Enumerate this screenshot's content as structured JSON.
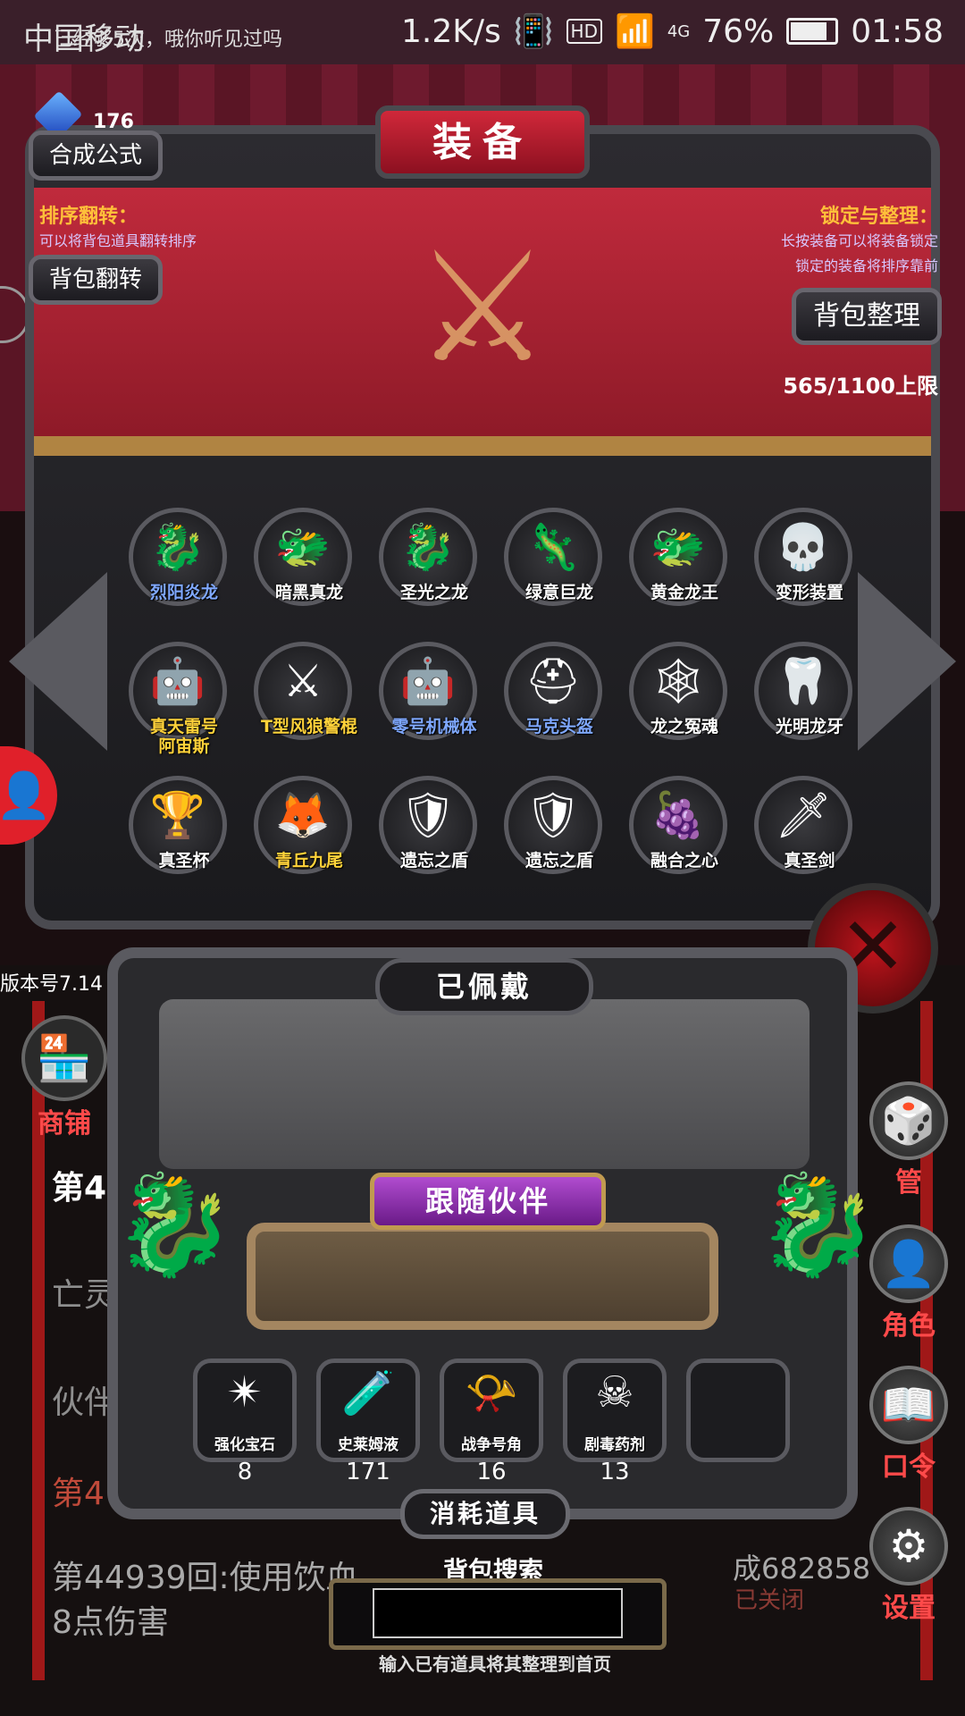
{
  "status_bar": {
    "carrier": "中国移动",
    "notification": "已经够5次，哦你听见过吗",
    "speed": "1.2K/s",
    "hd": "HD",
    "signal": "4G",
    "battery": "76%",
    "time": "01:58"
  },
  "gems": {
    "count": "176"
  },
  "panel": {
    "title": "装备",
    "synth_button": "合成公式",
    "flip_title": "排序翻转：",
    "flip_desc": "可以将背包道具翻转排序",
    "flip_button": "背包翻转",
    "lock_title": "锁定与整理：",
    "lock_desc1": "长按装备可以将装备锁定",
    "lock_desc2": "锁定的装备将排序靠前",
    "sort_button": "背包整理",
    "capacity": "565/1100上限"
  },
  "items": [
    {
      "name": "烈阳炎龙",
      "color": "blue",
      "icon": "dragon-red-icon",
      "glyph": "🐉"
    },
    {
      "name": "暗黑真龙",
      "color": "white",
      "icon": "dragon-ice-icon",
      "glyph": "🐲"
    },
    {
      "name": "圣光之龙",
      "color": "white",
      "icon": "dragon-gold-icon",
      "glyph": "🐉"
    },
    {
      "name": "绿意巨龙",
      "color": "white",
      "icon": "dragon-green-icon",
      "glyph": "🦎"
    },
    {
      "name": "黄金龙王",
      "color": "white",
      "icon": "dragon-king-icon",
      "glyph": "🐲"
    },
    {
      "name": "变形装置",
      "color": "white",
      "icon": "skull-device-icon",
      "glyph": "💀"
    },
    {
      "name": "真天雷号\n阿宙斯",
      "color": "yellow",
      "icon": "mech-angel-icon",
      "glyph": "🤖"
    },
    {
      "name": "T型风狼警棍",
      "color": "yellow",
      "icon": "baton-icon",
      "glyph": "⚔"
    },
    {
      "name": "零号机械体",
      "color": "blue",
      "icon": "robot-icon",
      "glyph": "🤖"
    },
    {
      "name": "马克头盔",
      "color": "blue",
      "icon": "helmet-icon",
      "glyph": "⛑"
    },
    {
      "name": "龙之冤魂",
      "color": "white",
      "icon": "spirit-icon",
      "glyph": "🕸"
    },
    {
      "name": "光明龙牙",
      "color": "white",
      "icon": "fang-icon",
      "glyph": "🦷"
    },
    {
      "name": "真圣杯",
      "color": "white",
      "icon": "grail-icon",
      "glyph": "🏆"
    },
    {
      "name": "青丘九尾",
      "color": "yellow",
      "icon": "fox-icon",
      "glyph": "🦊"
    },
    {
      "name": "遗忘之盾",
      "color": "white",
      "icon": "shield-red-icon",
      "glyph": "🛡"
    },
    {
      "name": "遗忘之盾",
      "color": "white",
      "icon": "shield-red-icon",
      "glyph": "🛡"
    },
    {
      "name": "融合之心",
      "color": "white",
      "icon": "heart-fusion-icon",
      "glyph": "🍇"
    },
    {
      "name": "真圣剑",
      "color": "white",
      "icon": "sword-icon",
      "glyph": "🗡"
    }
  ],
  "version": "版本号7.14",
  "shop": {
    "label": "商铺",
    "glyph": "🏪"
  },
  "wear": {
    "title": "已佩戴",
    "follow_title": "跟随伙伴"
  },
  "consumables": {
    "title": "消耗道具",
    "items": [
      {
        "name": "强化宝石",
        "count": "8",
        "glyph": "✴"
      },
      {
        "name": "史莱姆液",
        "count": "171",
        "glyph": "🧪"
      },
      {
        "name": "战争号角",
        "count": "16",
        "glyph": "📯"
      },
      {
        "name": "剧毒药剂",
        "count": "13",
        "glyph": "☠"
      },
      {
        "name": "",
        "count": "",
        "glyph": ""
      }
    ]
  },
  "search": {
    "label": "背包搜索",
    "value": "",
    "hint": "输入已有道具将其整理到首页"
  },
  "side_menu": {
    "manage": "管",
    "role": "角色",
    "code": "口令",
    "settings": "设置"
  },
  "log": {
    "line1": "第4",
    "line2": "亡灵",
    "line3": "伙伴",
    "line4": "第4",
    "line5": "第44939回:使用饮血",
    "line6": "8点伤害",
    "tail": "成682858",
    "closed": "已关闭"
  },
  "colors": {
    "accent_red": "#c0141c",
    "gold_text": "#ffc03a",
    "blue_name": "#7fa8ff",
    "yellow_name": "#ffd23a"
  }
}
